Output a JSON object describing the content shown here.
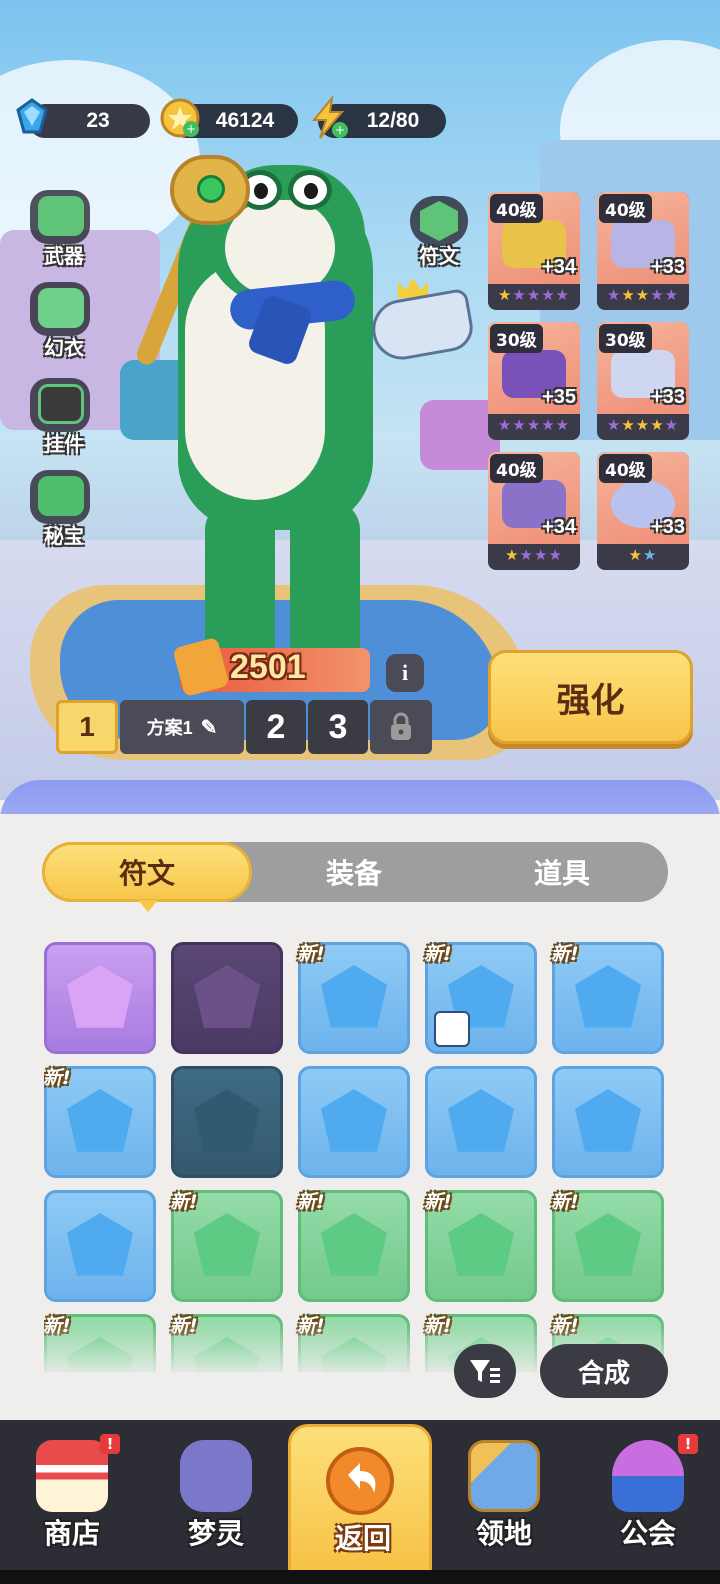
{
  "currencies": {
    "diamonds": "23",
    "gold": "46124",
    "energy": "12/80"
  },
  "side_menu": {
    "weapon": "武器",
    "outfit": "幻衣",
    "pendant": "挂件",
    "treasure": "秘宝"
  },
  "rune_button": "符文",
  "equipment": [
    {
      "level": "40级",
      "plus": "+34",
      "stars": 5
    },
    {
      "level": "40级",
      "plus": "+33",
      "stars": 5
    },
    {
      "level": "30级",
      "plus": "+35",
      "stars": 5
    },
    {
      "level": "30级",
      "plus": "+33",
      "stars": 5
    },
    {
      "level": "40级",
      "plus": "+34",
      "stars": 4
    },
    {
      "level": "40级",
      "plus": "+33",
      "stars": 2
    }
  ],
  "power": "2501",
  "info_icon": "i",
  "plans": {
    "plan1_number": "1",
    "plan1_name": "方案1",
    "plan2": "2",
    "plan3": "3"
  },
  "strengthen_button": "强化",
  "tabs": {
    "runes": "符文",
    "equipment": "装备",
    "items": "道具"
  },
  "rune_grid_new_tag": "新!",
  "merge_button": "合成",
  "nav": {
    "shop": "商店",
    "dream_spirit": "梦灵",
    "back": "返回",
    "territory": "领地",
    "guild": "公会",
    "notif_mark": "!"
  },
  "colors": {
    "accent_yellow": "#f7c64a",
    "panel_purple": "#8b9bf3",
    "nav_dark": "#2d2d36"
  }
}
